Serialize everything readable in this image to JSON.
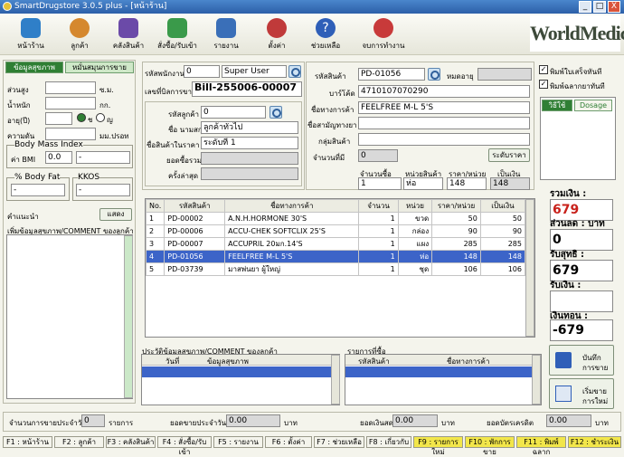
{
  "window": {
    "title": "SmartDrugstore 3.0.5 plus   - [หน้าร้าน]",
    "min": "_",
    "max": "□",
    "close": "X"
  },
  "toolbar": {
    "items": [
      {
        "label": "หน้าร้าน",
        "icon": "store-icon",
        "color": "#2f7fc8"
      },
      {
        "label": "ลูกค้า",
        "icon": "customers-icon",
        "color": "#d5882e"
      },
      {
        "label": "คลังสินค้า",
        "icon": "warehouse-icon",
        "color": "#6b4aa8"
      },
      {
        "label": "สั่งซื้อ/รับเข้า",
        "icon": "cart-icon",
        "color": "#3a9a4a"
      },
      {
        "label": "รายงาน",
        "icon": "report-icon",
        "color": "#3a6fb8"
      },
      {
        "label": "ตั้งค่า",
        "icon": "settings-icon",
        "color": "#c03a3a"
      },
      {
        "label": "ช่วยเหลือ",
        "icon": "help-icon",
        "color": "#2f5fb8"
      },
      {
        "label": "จบการทำงาน",
        "icon": "exit-icon",
        "color": "#c83a3a"
      }
    ],
    "brand_main": "WorldMedic",
    "brand_mark": "+"
  },
  "left": {
    "tabs": [
      "ข้อมูลสุขภาพ",
      "หมั่นสมุนการขาย"
    ],
    "height_label": "ส่วนสูง",
    "height_unit": "ซ.ม.",
    "weight_label": "น้ำหนัก",
    "weight_unit": "กก.",
    "age_label": "อายุ(ปี)",
    "gender_m": "ช",
    "gender_f": "ญ",
    "waist_label": "ความดัน",
    "waist_unit": "มม.ปรอท",
    "bmi_group": "Body Mass Index",
    "bmi_label": "ค่า BMI",
    "bmi_value": "0.0",
    "bmi_value2": "-",
    "bodyfat_group": "% Body Fat",
    "bodyfat_value": "-",
    "kkos_group": "KKOS",
    "kkos_value": "-",
    "suggest_label": "คำแนะนำ",
    "show_button": "แสดง",
    "comment_label": "เพิ่มข้อมูลสุขภาพ/COMMENT ของลูกค้า"
  },
  "sale": {
    "staff_label": "รหัสพนักงาน",
    "staff_code": "0",
    "staff_name": "Super User",
    "bill_label": "เลขที่บิลการขาย",
    "bill_no": "Bill-255006-00007",
    "cust_code_label": "รหัสลูกค้า",
    "cust_code": "0",
    "cust_name_label": "ชื่อ นามสกุล",
    "cust_name": "ลูกค้าทั่วไป",
    "cust_level_label": "ชื่อสินค้าในราคา",
    "cust_level": "ระดับที่ 1",
    "total_buy_label": "ยอดซื้อรวม",
    "visits_label": "ครั้งล่าสุด"
  },
  "product": {
    "code_label": "รหัสสินค้า",
    "code": "PD-01056",
    "exp_label": "หมดอายุ",
    "barcode_label": "บาร์โค้ด",
    "barcode": "4710107070290",
    "name_label": "ชื่อทางการค้า",
    "name": "FEELFREE M-L 5'S",
    "generic_label": "ชื่อสามัญทางยา",
    "group_label": "กลุ่มสินค้า",
    "stock_label": "จำนวนที่มี",
    "stock": "0",
    "price_button": "ระดับราคา",
    "qty_label": "จำนวนซื้อ",
    "qty": "1",
    "unit_label": "หน่วยสินค้า",
    "unit": "ห่อ",
    "unit_price_label": "ราคา/หน่วย",
    "unit_price": "148",
    "amount_label": "เป็นเงิน",
    "amount": "148"
  },
  "options": {
    "print_receipt": "พิมพ์ใบเสร็จทันที",
    "print_label": "พิมพ์ฉลากยาทันที",
    "tab_info": "วิธีใช้",
    "tab_dosage": "Dosage"
  },
  "items_table": {
    "headers": [
      "No.",
      "รหัสสินค้า",
      "ชื่อทางการค้า",
      "จำนวน",
      "หน่วย",
      "ราคา/หน่วย",
      "เป็นเงิน"
    ],
    "rows": [
      [
        "1",
        "PD-00002",
        "A.N.H.HORMONE 30'S",
        "1",
        "ขวด",
        "50",
        "50"
      ],
      [
        "2",
        "PD-00006",
        "ACCU-CHEK SOFTCLIX 25'S",
        "1",
        "กล่อง",
        "90",
        "90"
      ],
      [
        "3",
        "PD-00007",
        "ACCUPRIL 20มก.14'S",
        "1",
        "แผง",
        "285",
        "285"
      ],
      [
        "4",
        "PD-01056",
        "FEELFREE M-L 5'S",
        "1",
        "ห่อ",
        "148",
        "148"
      ],
      [
        "5",
        "PD-03739",
        "มาสพ่นยา ผู้ใหญ่",
        "1",
        "ชุด",
        "106",
        "106"
      ]
    ],
    "selected_row": 3
  },
  "totals": {
    "total_label": "รวมเงิน :",
    "total": "679",
    "discount_label": "ส่วนลด : บาท",
    "discount": "0",
    "net_label": "รับสุทธิ :",
    "net": "679",
    "paid_label": "รับเงิน :",
    "paid": "",
    "change_label": "เงินทอน :",
    "change": "-679"
  },
  "history": {
    "label": "ประวัติข้อมูลสุขภาพ/COMMENT ของลูกค้า",
    "headers": [
      "วันที่",
      "ข้อมูลสุขภาพ"
    ]
  },
  "last_items": {
    "label": "รายการที่ซื้อ",
    "headers": [
      "รหัสสินค้า",
      "ชื่อทางการค้า"
    ]
  },
  "actions": {
    "save": [
      "บันทึก",
      "การขาย"
    ],
    "new": [
      "เริ่มขาย",
      "การใหม่"
    ]
  },
  "summary": {
    "sales_count_label": "จำนวนการขายประจำวัน",
    "sales_count": "0",
    "sales_count_unit": "รายการ",
    "daily_total_label": "ยอดขายประจำวัน",
    "daily_total": "0.00",
    "daily_total_unit": "บาท",
    "cash_label": "ยอดเงินสด",
    "cash": "0.00",
    "cash_unit": "บาท",
    "credit_label": "ยอดบัตรเครดิต",
    "credit": "0.00",
    "credit_unit": "บาท"
  },
  "fkeys": [
    "F1 : หน้าร้าน",
    "F2 : ลูกค้า",
    "F3 : คลังสินค้า",
    "F4 : สั่งซื้อ/รับเข้า",
    "F5 : รายงาน",
    "F6 : ตั้งค่า",
    "F7 : ช่วยเหลือ",
    "F8 : เกี่ยวกับ",
    "F9 : รายการใหม่",
    "F10 : พักการขาย",
    "F11 : พิมพ์ฉลาก",
    "F12 : ชำระเงิน"
  ]
}
